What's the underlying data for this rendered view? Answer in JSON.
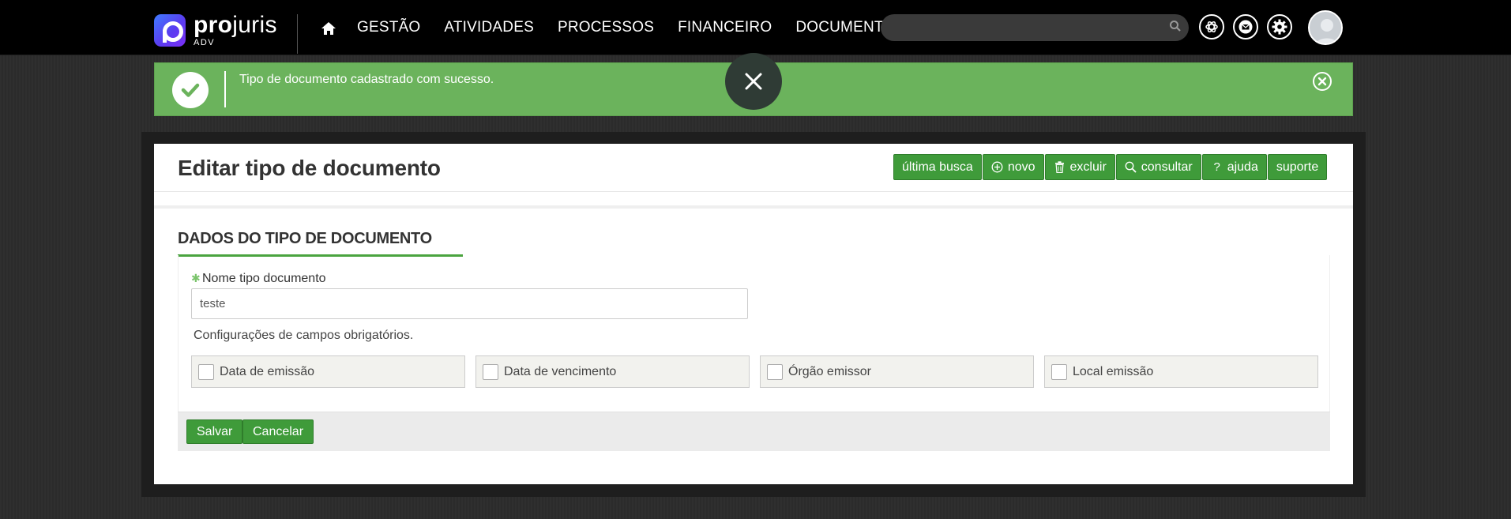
{
  "header": {
    "logo_word_bold": "pro",
    "logo_word_light": "juris",
    "logo_sub": "ADV",
    "nav": [
      "GESTÃO",
      "ATIVIDADES",
      "PROCESSOS",
      "FINANCEIRO",
      "DOCUMENTOS"
    ],
    "search_placeholder": ""
  },
  "alert": {
    "message": "Tipo de documento cadastrado com sucesso.",
    "color": "#6bb35c"
  },
  "page": {
    "title": "Editar tipo de documento",
    "toolbar": {
      "ultima_busca": "última busca",
      "novo": "novo",
      "excluir": "excluir",
      "consultar": "consultar",
      "ajuda": "ajuda",
      "suporte": "suporte"
    },
    "section_title": "DADOS DO TIPO DE DOCUMENTO",
    "required_mark": "✱",
    "name_label": "Nome tipo documento",
    "name_value": "teste",
    "config_label": "Configurações de campos obrigatórios.",
    "checkboxes": [
      "Data de emissão",
      "Data de vencimento",
      "Órgão emissor",
      "Local emissão"
    ],
    "save_label": "Salvar",
    "cancel_label": "Cancelar"
  },
  "colors": {
    "accent_green": "#3f9b3a",
    "topbar": "#000000"
  }
}
